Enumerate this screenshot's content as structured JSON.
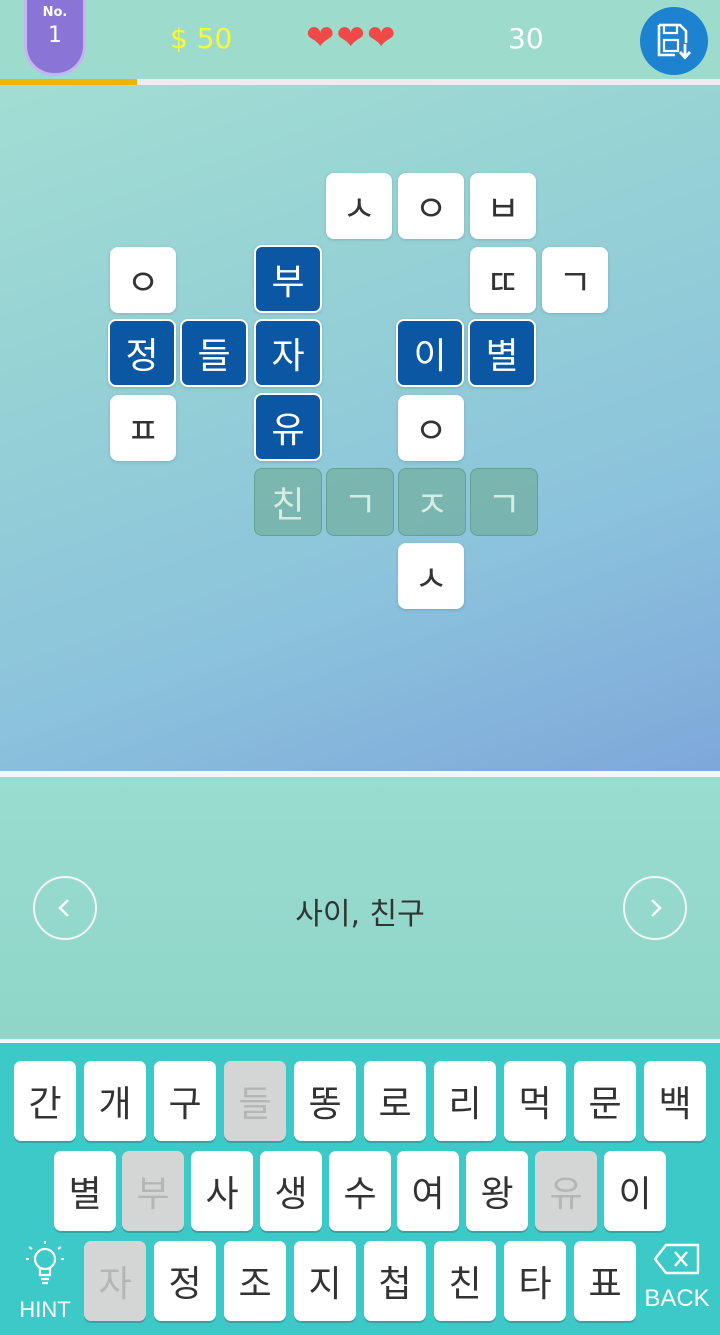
{
  "header": {
    "level_label": "No.",
    "level_number": "1",
    "money": "$ 50",
    "lives": 3,
    "score": "30",
    "progress": 0.19
  },
  "grid": {
    "row0": [
      "ㅅ",
      "ㅇ",
      "ㅂ"
    ],
    "row1": [
      "ㅇ",
      "부",
      "ㄸ",
      "ㄱ"
    ],
    "row2": [
      "정",
      "들",
      "자",
      "이",
      "별"
    ],
    "row3": [
      "ㅍ",
      "유",
      "ㅇ"
    ],
    "row4": [
      "친",
      "ㄱ",
      "ㅈ",
      "ㄱ"
    ],
    "row5": [
      "ㅅ"
    ]
  },
  "clue": {
    "text": "사이, 친구"
  },
  "keyboard": {
    "row1": [
      "간",
      "개",
      "구",
      "들",
      "똥",
      "로",
      "리",
      "먹",
      "문",
      "백"
    ],
    "row2": [
      "별",
      "부",
      "사",
      "생",
      "수",
      "여",
      "왕",
      "유",
      "이"
    ],
    "row3": [
      "자",
      "정",
      "조",
      "지",
      "첩",
      "친",
      "타",
      "표"
    ],
    "hint_label": "HINT",
    "back_label": "BACK"
  }
}
